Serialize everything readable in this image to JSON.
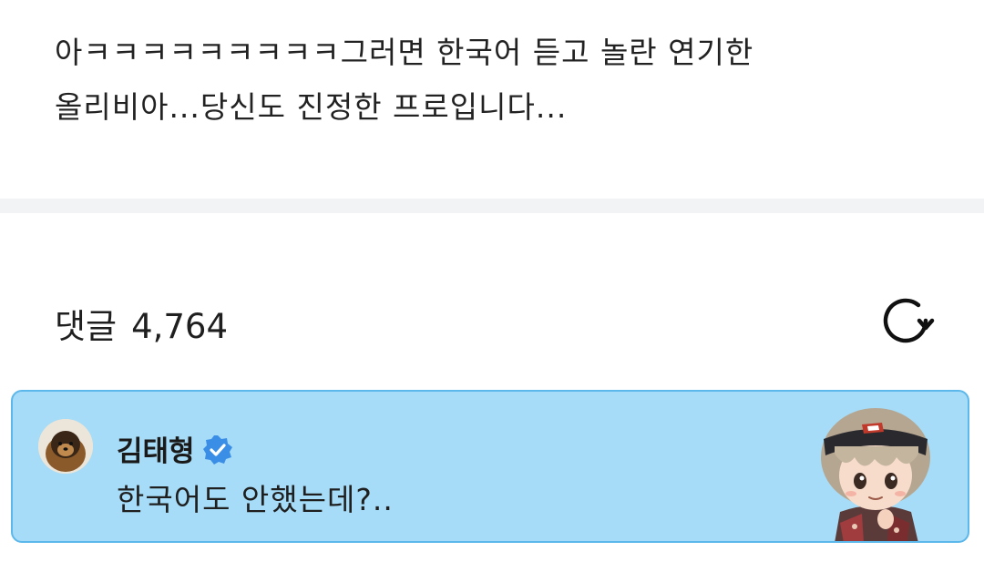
{
  "post": {
    "lines": [
      "아ㅋㅋㅋㅋㅋㅋㅋㅋㅋ그러면 한국어 듣고 놀란 연기한",
      "올리비아...당신도 진정한 프로입니다..."
    ]
  },
  "comments": {
    "label": "댓글",
    "count": "4,764",
    "refresh_icon": "refresh-icon"
  },
  "comment": {
    "author": "김태형",
    "verified_icon": "verified-badge-icon",
    "text": "한국어도 안했는데?..",
    "colors": {
      "card_bg": "#a6dcf7",
      "card_border": "#5cb7ea",
      "verified": "#3a8ee6"
    }
  }
}
